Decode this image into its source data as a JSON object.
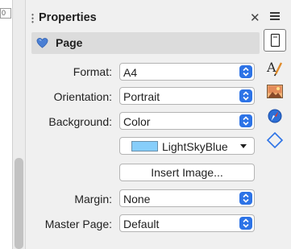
{
  "left_field_text": "0",
  "panel": {
    "title": "Properties",
    "close_glyph": "✕",
    "section": {
      "title": "Page",
      "icon": "heart-icon"
    }
  },
  "rows": {
    "format": {
      "label": "Format:",
      "value": "A4"
    },
    "orientation": {
      "label": "Orientation:",
      "value": "Portrait"
    },
    "background": {
      "label": "Background:",
      "value": "Color"
    },
    "color": {
      "name": "LightSkyBlue",
      "swatch": "#87cefa"
    },
    "insert_image": {
      "label": "Insert Image..."
    },
    "margin": {
      "label": "Margin:",
      "value": "None"
    },
    "master_page": {
      "label": "Master Page:",
      "value": "Default"
    }
  },
  "deck": {
    "menu_icon": "hamburger-menu-icon",
    "buttons": [
      "page-properties-icon",
      "styles-icon",
      "gallery-icon",
      "navigator-icon",
      "shapes-icon"
    ]
  },
  "colors": {
    "accent": "#2d73e6",
    "section_bg": "#dcdcdc",
    "panel_bg": "#f0f0f0"
  }
}
